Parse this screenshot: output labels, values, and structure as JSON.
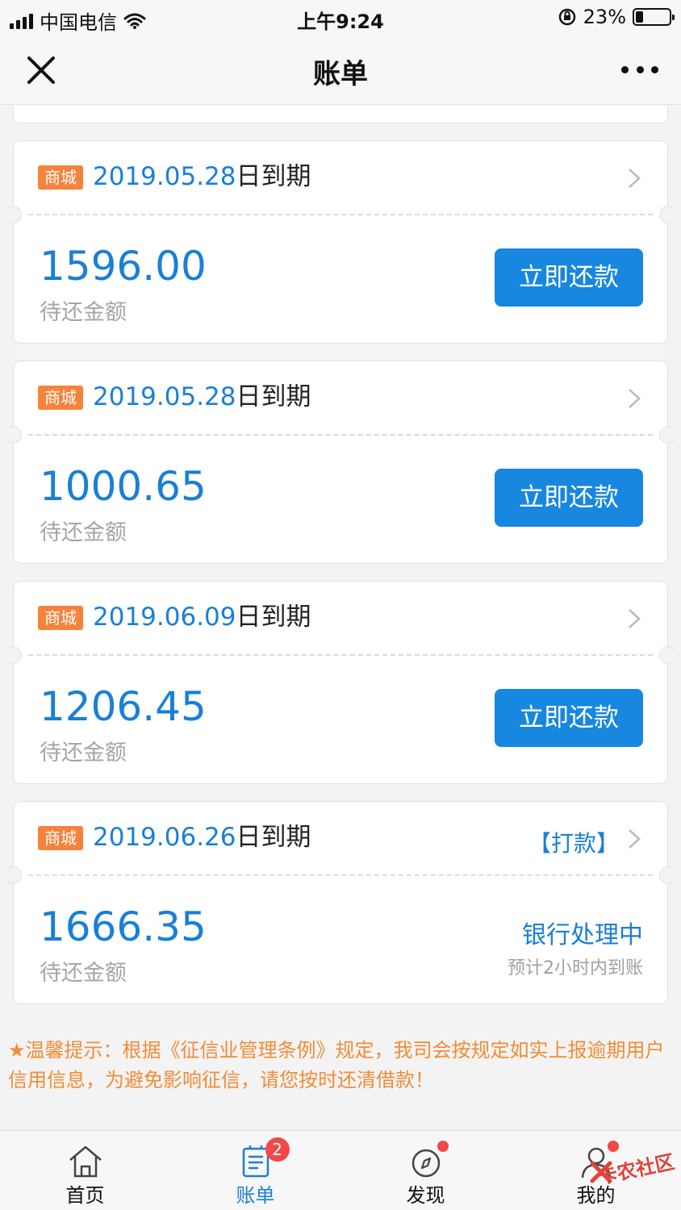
{
  "status_bar": {
    "carrier": "中国电信",
    "time": "上午9:24",
    "battery_percent": "23%",
    "battery_level": 0.23
  },
  "nav": {
    "title": "账单",
    "close_icon": "close-icon",
    "more_icon": "more-dots-icon"
  },
  "bills": [
    {
      "tag": "商城",
      "due_date": "2019.05.28",
      "due_suffix": "日到期",
      "amount": "1596.00",
      "amount_label": "待还金额",
      "action_label": "立即还款"
    },
    {
      "tag": "商城",
      "due_date": "2019.05.28",
      "due_suffix": "日到期",
      "amount": "1000.65",
      "amount_label": "待还金额",
      "action_label": "立即还款"
    },
    {
      "tag": "商城",
      "due_date": "2019.06.09",
      "due_suffix": "日到期",
      "amount": "1206.45",
      "amount_label": "待还金额",
      "action_label": "立即还款"
    },
    {
      "tag": "商城",
      "due_date": "2019.06.26",
      "due_suffix": "日到期",
      "extra_link": "【打款】",
      "amount": "1666.35",
      "amount_label": "待还金额",
      "status": "银行处理中",
      "status_note": "预计2小时内到账"
    }
  ],
  "tip": "★温馨提示：根据《征信业管理条例》规定，我司会按规定如实上报逾期用户信用信息，为避免影响征信，请您按时还清借款！",
  "tabs": [
    {
      "label": "首页",
      "icon": "home-icon"
    },
    {
      "label": "账单",
      "icon": "bill-icon",
      "badge": "2",
      "active": true
    },
    {
      "label": "发现",
      "icon": "compass-icon",
      "dot": true
    },
    {
      "label": "我的",
      "icon": "user-icon",
      "dot": true
    }
  ],
  "watermark": "卡农社区",
  "colors": {
    "accent": "#1787e0",
    "tag": "#f5833b",
    "tip": "#f28c35",
    "badge": "#f2484a"
  }
}
